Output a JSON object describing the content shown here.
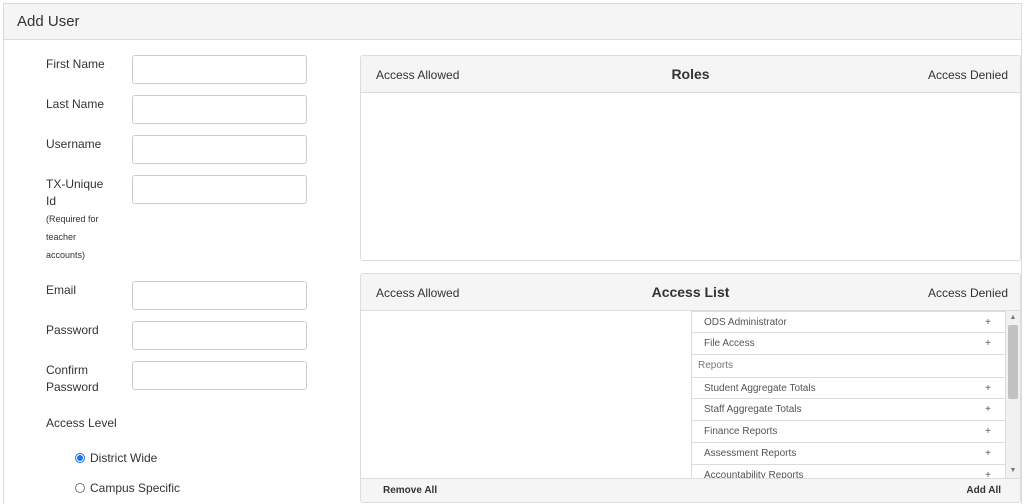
{
  "page": {
    "title": "Add User"
  },
  "form": {
    "first_name_label": "First Name",
    "last_name_label": "Last Name",
    "username_label": "Username",
    "tx_unique_label_1": "TX-Unique",
    "tx_unique_label_2": "Id",
    "tx_unique_note_1": "(Required for",
    "tx_unique_note_2": "teacher",
    "tx_unique_note_3": "accounts)",
    "email_label": "Email",
    "password_label": "Password",
    "confirm_label_1": "Confirm",
    "confirm_label_2": "Password",
    "first_name_value": "",
    "last_name_value": "",
    "username_value": "",
    "tx_unique_value": "",
    "email_value": "",
    "password_value": "",
    "confirm_value": "",
    "access_level_label": "Access Level",
    "access_options": [
      {
        "label": "District Wide",
        "checked": true
      },
      {
        "label": "Campus Specific",
        "checked": false
      }
    ]
  },
  "roles_panel": {
    "left": "Access Allowed",
    "title": "Roles",
    "right": "Access Denied"
  },
  "access_panel": {
    "left": "Access Allowed",
    "title": "Access List",
    "right": "Access Denied",
    "items": [
      {
        "label": "ODS Administrator",
        "action": "+"
      },
      {
        "label": "File Access",
        "action": "+"
      },
      {
        "group": "Reports"
      },
      {
        "label": "Student Aggregate Totals",
        "action": "+"
      },
      {
        "label": "Staff Aggregate Totals",
        "action": "+"
      },
      {
        "label": "Finance Reports",
        "action": "+"
      },
      {
        "label": "Assessment Reports",
        "action": "+"
      },
      {
        "label": "Accountability Reports",
        "action": "+"
      }
    ],
    "remove_all": "Remove All",
    "add_all": "Add All"
  },
  "icons": {
    "scroll_up": "scroll-up-arrow-icon",
    "scroll_down": "scroll-down-arrow-icon"
  },
  "colors": {
    "accent": "#1a73e8",
    "header_bg": "#f5f5f5",
    "border": "#dcdcdc"
  }
}
